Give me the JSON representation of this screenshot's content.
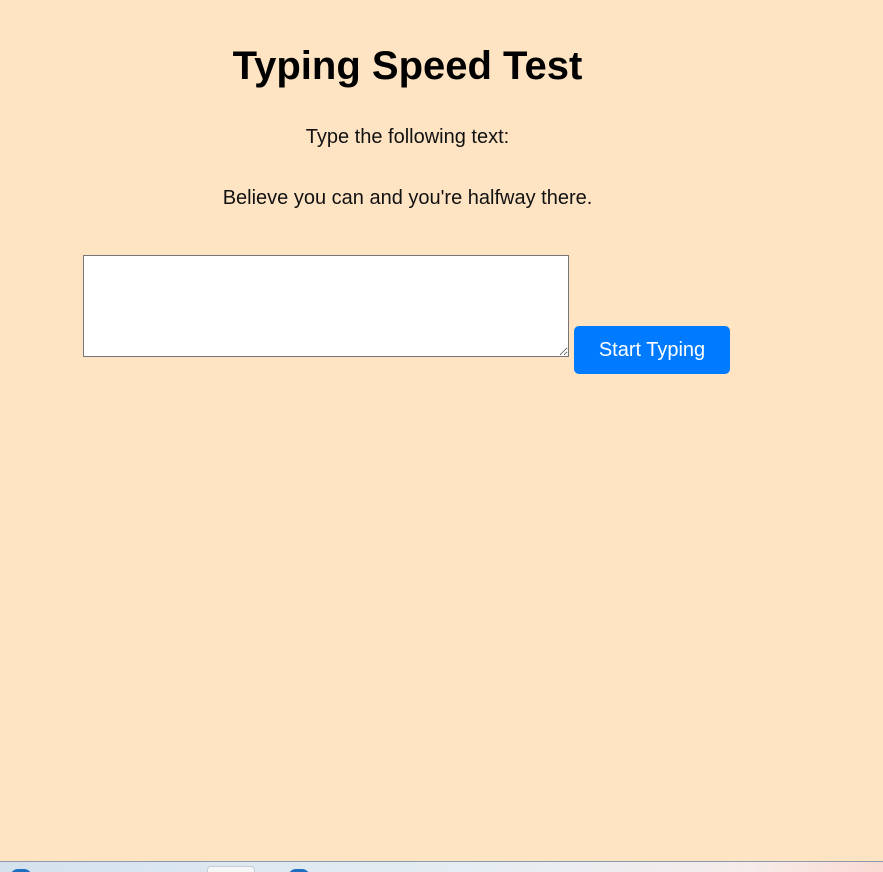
{
  "page": {
    "title": "Typing Speed Test",
    "instruction": "Type the following text:",
    "target_text": "Believe you can and you're halfway there."
  },
  "typing_input": {
    "value": "",
    "placeholder": ""
  },
  "start_button": {
    "label": "Start Typing"
  },
  "colors": {
    "background": "#ffe4c4",
    "button": "#007bff",
    "button_text": "#ffffff"
  },
  "taskbar": {
    "icons": [
      "app-icon",
      "taskbar-button",
      "app-icon"
    ]
  }
}
